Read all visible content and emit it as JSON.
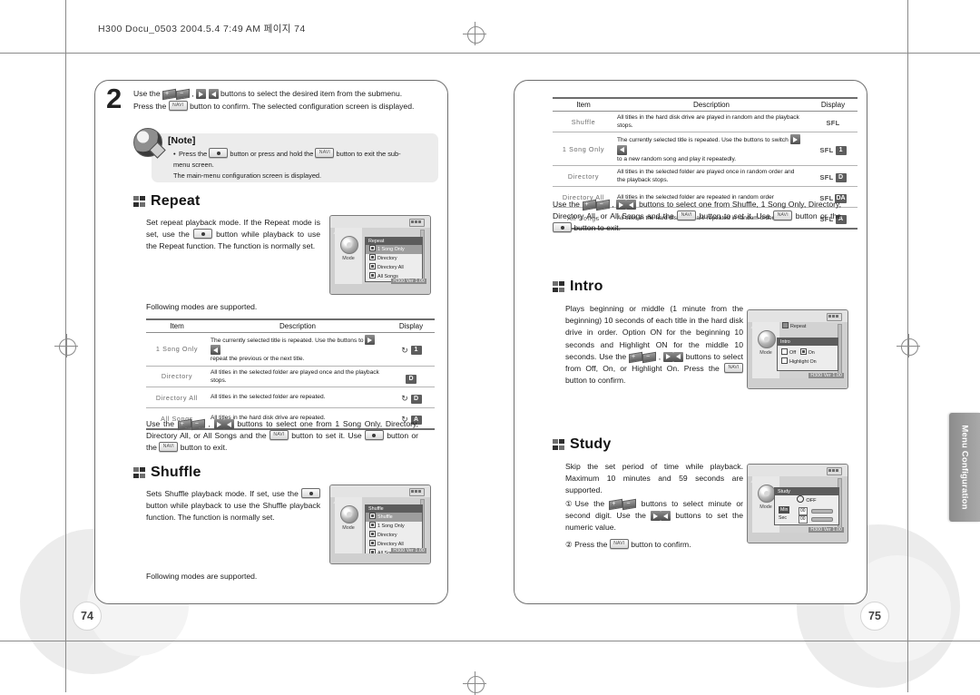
{
  "running_head": "H300 Docu_0503  2004.5.4 7:49 AM  페이지 74",
  "side_tab": {
    "label": "Menu Configuration"
  },
  "left_page": {
    "folio": "74",
    "step": {
      "number": "2",
      "line1_a": "Use the",
      "line1_b": ",",
      "line1_c": "buttons to select the desired item from the submenu.",
      "line2_a": "Press the",
      "line2_b": "button to confirm. The selected configuration screen is displayed."
    },
    "note": {
      "title": "[Note]",
      "line1_a": "Press the",
      "line1_b": "button or press and hold the",
      "line1_c": "button to exit the sub-",
      "line2": "menu screen.",
      "line3": "The main-menu configuration screen is displayed."
    },
    "repeat": {
      "title": "Repeat",
      "body_a": "Set repeat playback mode. If the Repeat mode is set, use the",
      "body_b": "button while playback to use the Repeat function. The function is normally set.",
      "following": "Following modes are supported.",
      "table": {
        "headers": [
          "Item",
          "Description",
          "Display"
        ],
        "rows": [
          {
            "item": "1 Song Only",
            "desc_a": "The currently selected title is repeated. Use the  buttons to",
            "desc_b": "repeat the previous or the next title.",
            "display": {
              "repeat_icon": true,
              "badge": "1"
            }
          },
          {
            "item": "Directory",
            "desc_a": "All titles in the selected folder are played once and the playback stops.",
            "desc_b": "",
            "display": {
              "repeat_icon": false,
              "badge": "D"
            }
          },
          {
            "item": "Directory All",
            "desc_a": "All titles in the selected folder are repeated.",
            "desc_b": "",
            "display": {
              "repeat_icon": true,
              "badge": "D"
            }
          },
          {
            "item": "All Songs",
            "desc_a": "All titles in the hard disk drive are repeated.",
            "desc_b": "",
            "display": {
              "repeat_icon": true,
              "badge": "A"
            }
          }
        ]
      },
      "device": {
        "mode_label": "Mode",
        "version": "H300 Ver 1.00",
        "popup_title": "Repeat",
        "items": [
          "1 Song Only",
          "Directory",
          "Directory All",
          "All Songs"
        ],
        "selected_index": 0
      }
    },
    "repeat_usage": {
      "a": "Use the",
      "b": ",",
      "c": "buttons to select one from 1 Song Only, Directory, Directory All, or All Songs and the",
      "d": "button to set it. Use",
      "e": "button or the",
      "f": "button to exit."
    },
    "shuffle": {
      "title": "Shuffle",
      "body_a": "Sets Shuffle playback mode. If set, use the",
      "body_b": "button while playback to use the Shuffle playback function. The function is normally set.",
      "following": "Following modes are supported.",
      "device": {
        "mode_label": "Mode",
        "version": "H300 Ver 1.00",
        "popup_title": "Shuffle",
        "items": [
          "Shuffle",
          "1 Song Only",
          "Directory",
          "Directory All",
          "All Songs"
        ],
        "selected_index": 0
      }
    }
  },
  "right_page": {
    "folio": "75",
    "shuffle_table": {
      "headers": [
        "Item",
        "Description",
        "Display"
      ],
      "rows": [
        {
          "item": "Shuffle",
          "desc_a": "All titles in the hard disk drive are played in random and the playback",
          "desc_b": "stops.",
          "display": {
            "sfl": "SFL",
            "badge": ""
          }
        },
        {
          "item": "1 Song Only",
          "desc_a": "The currently selected title is repeated. Use the   buttons to switch",
          "desc_b": "to a new random song and play it repeatedly.",
          "display": {
            "sfl": "SFL",
            "badge": "1"
          }
        },
        {
          "item": "Directory",
          "desc_a": "All titles in the selected folder are played once in random order and",
          "desc_b": "the playback stops.",
          "display": {
            "sfl": "SFL",
            "badge": "D"
          }
        },
        {
          "item": "Directory All",
          "desc_a": "All titles in the selected folder are repeated in random order",
          "desc_b": "",
          "display": {
            "sfl": "SFL",
            "badge": "DA"
          }
        },
        {
          "item": "All Songs",
          "desc_a": "All titles in the hard disk drive are repeated in random order.",
          "desc_b": "",
          "display": {
            "sfl": "SFL",
            "badge": "A"
          }
        }
      ]
    },
    "shuffle_usage": {
      "a": "Use the",
      "b": ",",
      "c": "buttons to select one from Shuffle, 1 Song Only, Directory, Directory All, or All Songs and the",
      "d": "button to set it. Use",
      "e": "button or the",
      "f": "button to exit."
    },
    "intro": {
      "title": "Intro",
      "body_a": "Plays beginning or middle (1 minute from the beginning) 10 seconds of each title in the hard disk drive in order. Option ON for the beginning 10 seconds and Highlight ON for the middle 10 seconds.",
      "body_b": "Use the",
      "body_c": ",",
      "body_d": "buttons to select from Off, On, or Highlight On. Press the",
      "body_e": "button to confirm.",
      "device": {
        "mode_label": "Mode",
        "version": "H300 Ver 1.00",
        "bg_item": "Repeat",
        "popup_title": "Intro",
        "options": [
          "Off",
          "On",
          "Highlight On"
        ],
        "selected_option": "On"
      }
    },
    "study": {
      "title": "Study",
      "body_a": "Skip the set period of time while playback. Maximum 10 minutes and 59 seconds are supported.",
      "step1_num": "①",
      "step1_a": "Use the",
      "step1_b": "buttons to select minute or second digit. Use the",
      "step1_c": "buttons to set the numeric value.",
      "step2_num": "②",
      "step2_a": "Press the",
      "step2_b": "button to confirm.",
      "device": {
        "mode_label": "Mode",
        "version": "H300 Ver 1.00",
        "popup_title": "Study",
        "off_label": "OFF",
        "min_label": "Min",
        "min_value": "00",
        "sec_label": "Sec",
        "sec_value": "00"
      }
    }
  },
  "keys": {
    "nav": "NAVI",
    "rec": "REC",
    "vol_plus": "+",
    "vol_minus": "−"
  }
}
